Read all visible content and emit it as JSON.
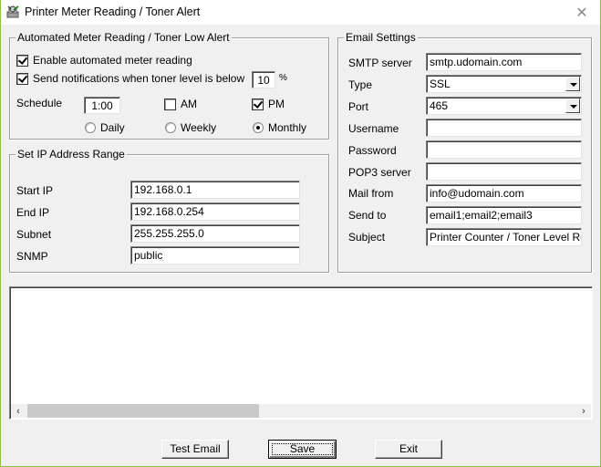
{
  "window": {
    "title": "Printer Meter Reading / Toner Alert",
    "close_icon": "close-icon",
    "app_icon": "printer-wrench-icon"
  },
  "automated": {
    "legend": "Automated Meter Reading / Toner Low Alert",
    "enable_label": "Enable automated meter reading",
    "enable_checked": true,
    "notify_label": "Send notifications when toner level is below",
    "notify_checked": true,
    "threshold_value": "10",
    "threshold_unit": "%",
    "schedule_label": "Schedule",
    "schedule_time": "1:00",
    "am_label": "AM",
    "am_checked": false,
    "pm_label": "PM",
    "pm_checked": true,
    "frequency": {
      "options": [
        "Daily",
        "Weekly",
        "Monthly"
      ],
      "selected": "Monthly"
    }
  },
  "ip_range": {
    "legend": "Set IP Address Range",
    "fields": [
      {
        "label": "Start IP",
        "value": "192.168.0.1"
      },
      {
        "label": "End IP",
        "value": "192.168.0.254"
      },
      {
        "label": "Subnet",
        "value": "255.255.255.0"
      },
      {
        "label": "SNMP",
        "value": "public"
      }
    ]
  },
  "email": {
    "legend": "Email Settings",
    "smtp_label": "SMTP server",
    "smtp_value": "smtp.udomain.com",
    "type_label": "Type",
    "type_value": "SSL",
    "port_label": "Port",
    "port_value": "465",
    "username_label": "Username",
    "username_value": "",
    "password_label": "Password",
    "password_value": "",
    "pop3_label": "POP3 server",
    "pop3_value": "",
    "mailfrom_label": "Mail from",
    "mailfrom_value": "info@udomain.com",
    "sendto_label": "Send to",
    "sendto_value": "email1;email2;email3",
    "subject_label": "Subject",
    "subject_value": "Printer Counter / Toner Level Repo"
  },
  "log": {
    "content": "",
    "scroll_left_icon": "chevron-left-icon",
    "scroll_right_icon": "chevron-right-icon"
  },
  "buttons": {
    "test_email": "Test Email",
    "save": "Save",
    "exit": "Exit"
  }
}
